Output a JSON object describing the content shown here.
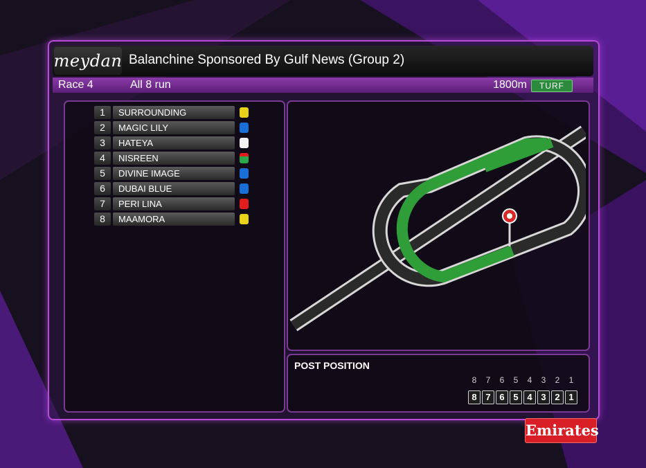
{
  "header": {
    "logo": "meydan",
    "title": "Balanchine Sponsored By Gulf News (Group 2)"
  },
  "race_info": {
    "race": "Race 4",
    "runners": "All 8 run",
    "distance": "1800m",
    "surface": "TURF"
  },
  "runners": [
    {
      "number": "1",
      "name": "SURROUNDING",
      "silk_color": "#e8d21a"
    },
    {
      "number": "2",
      "name": "MAGIC LILY",
      "silk_color": "#1a6fd6"
    },
    {
      "number": "3",
      "name": "HATEYA",
      "silk_color": "#f2f2f2"
    },
    {
      "number": "4",
      "name": "NISREEN",
      "silk_color": "#2aa84a"
    },
    {
      "number": "5",
      "name": "DIVINE IMAGE",
      "silk_color": "#1a6fd6"
    },
    {
      "number": "6",
      "name": "DUBAI BLUE",
      "silk_color": "#1a6fd6"
    },
    {
      "number": "7",
      "name": "PERI LINA",
      "silk_color": "#e21d1d"
    },
    {
      "number": "8",
      "name": "MAAMORA",
      "silk_color": "#e8d21a"
    }
  ],
  "post_position": {
    "title": "POST POSITION",
    "labels": [
      "8",
      "7",
      "6",
      "5",
      "4",
      "3",
      "2",
      "1"
    ],
    "boxes": [
      "8",
      "7",
      "6",
      "5",
      "4",
      "3",
      "2",
      "1"
    ]
  },
  "sponsor": "Emirates",
  "colors": {
    "accent": "#b84bd8",
    "turf_green": "#2f9e38",
    "track_dark": "#2a2a2a",
    "marker_red": "#d62828"
  }
}
